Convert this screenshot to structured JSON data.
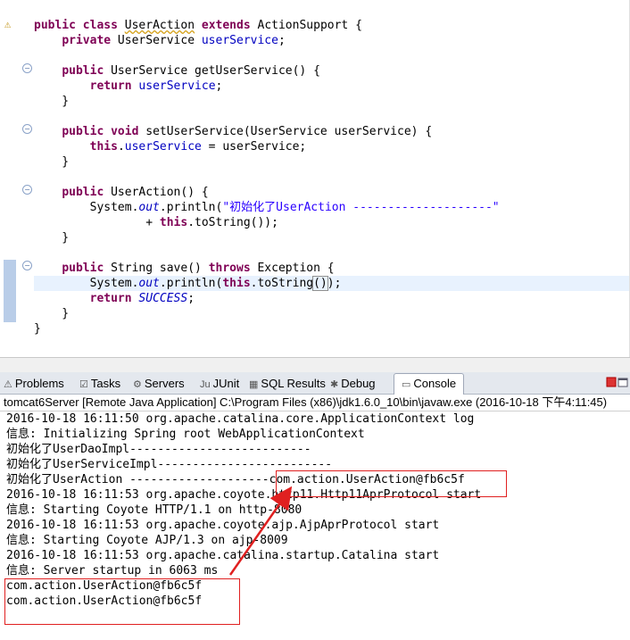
{
  "editor": {
    "lines": [
      {
        "parts": [
          [
            "public",
            "kw"
          ],
          [
            " ",
            ""
          ],
          [
            "class",
            "kw"
          ],
          [
            " ",
            ""
          ],
          [
            "UserAction",
            "sq"
          ],
          [
            " ",
            ""
          ],
          [
            "extends",
            "kw"
          ],
          [
            " ActionSupport {",
            ""
          ]
        ]
      },
      {
        "parts": [
          [
            "    ",
            ""
          ],
          [
            "private",
            "kw"
          ],
          [
            " UserService ",
            ""
          ],
          [
            "userService",
            "fd"
          ],
          [
            ";",
            ""
          ]
        ]
      },
      {
        "parts": [
          [
            "",
            ""
          ]
        ]
      },
      {
        "parts": [
          [
            "    ",
            ""
          ],
          [
            "public",
            "kw"
          ],
          [
            " UserService getUserService() {",
            ""
          ]
        ]
      },
      {
        "parts": [
          [
            "        ",
            ""
          ],
          [
            "return",
            "kw"
          ],
          [
            " ",
            ""
          ],
          [
            "userService",
            "fd"
          ],
          [
            ";",
            ""
          ]
        ]
      },
      {
        "parts": [
          [
            "    }",
            ""
          ]
        ]
      },
      {
        "parts": [
          [
            "",
            ""
          ]
        ]
      },
      {
        "parts": [
          [
            "    ",
            ""
          ],
          [
            "public",
            "kw"
          ],
          [
            " ",
            ""
          ],
          [
            "void",
            "kw"
          ],
          [
            " setUserService(UserService userService) {",
            ""
          ]
        ]
      },
      {
        "parts": [
          [
            "        ",
            ""
          ],
          [
            "this",
            "kw"
          ],
          [
            ".",
            ""
          ],
          [
            "userService",
            "fd"
          ],
          [
            " = userService;",
            ""
          ]
        ]
      },
      {
        "parts": [
          [
            "    }",
            ""
          ]
        ]
      },
      {
        "parts": [
          [
            "",
            ""
          ]
        ]
      },
      {
        "parts": [
          [
            "    ",
            ""
          ],
          [
            "public",
            "kw"
          ],
          [
            " UserAction() {",
            ""
          ]
        ]
      },
      {
        "parts": [
          [
            "        System.",
            ""
          ],
          [
            "out",
            "it"
          ],
          [
            ".println(",
            ""
          ],
          [
            "\"初始化了UserAction --------------------\"",
            "st"
          ]
        ]
      },
      {
        "parts": [
          [
            "                + ",
            ""
          ],
          [
            "this",
            "kw"
          ],
          [
            ".toString());",
            ""
          ]
        ]
      },
      {
        "parts": [
          [
            "    }",
            ""
          ]
        ]
      },
      {
        "parts": [
          [
            "",
            ""
          ]
        ]
      },
      {
        "parts": [
          [
            "    ",
            ""
          ],
          [
            "public",
            "kw"
          ],
          [
            " String save() ",
            ""
          ],
          [
            "throws",
            "kw"
          ],
          [
            " Exception {",
            ""
          ]
        ]
      },
      {
        "parts": [
          [
            "        System.",
            ""
          ],
          [
            "out",
            "it"
          ],
          [
            ".println(",
            ""
          ],
          [
            "this",
            "kw"
          ],
          [
            ".toString",
            ""
          ],
          [
            "()",
            "bx"
          ],
          [
            ");",
            ""
          ]
        ]
      },
      {
        "parts": [
          [
            "        ",
            ""
          ],
          [
            "return",
            "kw"
          ],
          [
            " ",
            ""
          ],
          [
            "SUCCESS",
            "it"
          ],
          [
            ";",
            ""
          ]
        ]
      },
      {
        "parts": [
          [
            "    }",
            ""
          ]
        ]
      },
      {
        "parts": [
          [
            "}",
            ""
          ]
        ]
      }
    ]
  },
  "tabs": [
    {
      "label": "Problems",
      "icon": "problems-icon",
      "glyph": "⚠"
    },
    {
      "label": "Tasks",
      "icon": "tasks-icon",
      "glyph": "☑"
    },
    {
      "label": "Servers",
      "icon": "servers-icon",
      "glyph": "⚙"
    },
    {
      "label": "JUnit",
      "icon": "junit-icon",
      "glyph": "Ju"
    },
    {
      "label": "SQL Results",
      "icon": "sql-results-icon",
      "glyph": "▦"
    },
    {
      "label": "Debug",
      "icon": "debug-icon",
      "glyph": "✱"
    },
    {
      "label": "Console",
      "icon": "console-icon",
      "glyph": "▭",
      "active": true
    }
  ],
  "console": {
    "info": "tomcat6Server [Remote Java Application] C:\\Program Files (x86)\\jdk1.6.0_10\\bin\\javaw.exe (2016-10-18 下午4:11:45)",
    "lines": [
      "2016-10-18 16:11:50 org.apache.catalina.core.ApplicationContext log",
      "信息: Initializing Spring root WebApplicationContext",
      "初始化了UserDaoImpl--------------------------",
      "初始化了UserServiceImpl-------------------------",
      "初始化了UserAction --------------------com.action.UserAction@fb6c5f",
      "2016-10-18 16:11:53 org.apache.coyote.http11.Http11AprProtocol start",
      "信息: Starting Coyote HTTP/1.1 on http-8080",
      "2016-10-18 16:11:53 org.apache.coyote.ajp.AjpAprProtocol start",
      "信息: Starting Coyote AJP/1.3 on ajp-8009",
      "2016-10-18 16:11:53 org.apache.catalina.startup.Catalina start",
      "信息: Server startup in 6063 ms",
      "com.action.UserAction@fb6c5f",
      "com.action.UserAction@fb6c5f"
    ]
  },
  "colors": {
    "annotation": "#e02020",
    "keyword": "#7f0055",
    "field": "#0000c0",
    "string": "#2a00ff"
  }
}
